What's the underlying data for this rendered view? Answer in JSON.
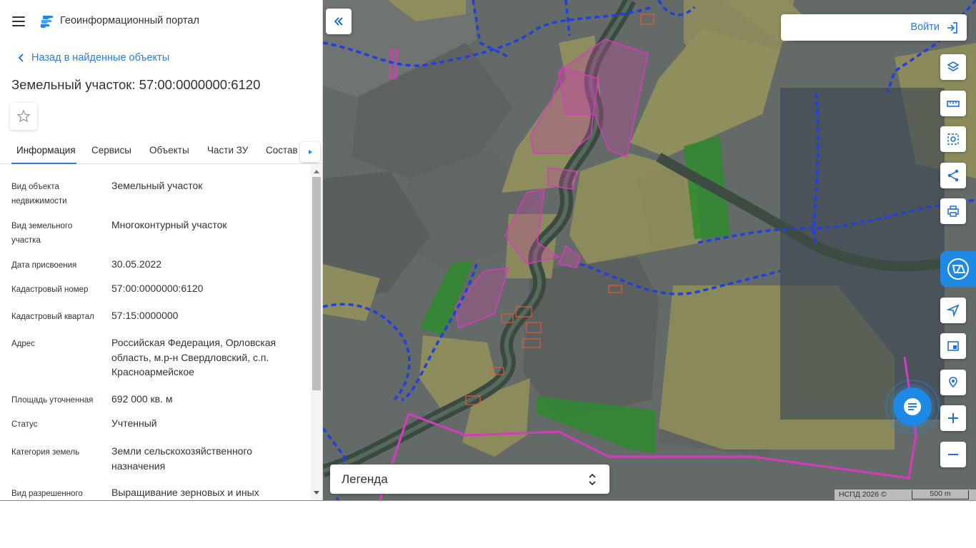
{
  "header": {
    "portal_title": "Геоинформационный портал",
    "menu_icon": "hamburger-menu-icon",
    "logo_icon": "portal-logo-icon"
  },
  "back_link": "Назад в найденные объекты",
  "object_title": "Земельный участок: 57:00:0000000:6120",
  "tabs": [
    {
      "label": "Информация",
      "active": true
    },
    {
      "label": "Сервисы",
      "active": false
    },
    {
      "label": "Объекты",
      "active": false
    },
    {
      "label": "Части ЗУ",
      "active": false
    },
    {
      "label": "Состав",
      "active": false
    }
  ],
  "info": [
    {
      "label": "Вид объекта недвижимости",
      "value": "Земельный участок"
    },
    {
      "label": "Вид земельного участка",
      "value": "Многоконтурный участок"
    },
    {
      "label": "Дата присвоения",
      "value": "30.05.2022"
    },
    {
      "label": "Кадастровый номер",
      "value": "57:00:0000000:6120"
    },
    {
      "label": "Кадастровый квартал",
      "value": "57:15:0000000"
    },
    {
      "label": "Адрес",
      "value": "Российская Федерация, Орловская область, м.р-н Свердловский, с.п. Красноармейское"
    },
    {
      "label": "Площадь уточненная",
      "value": "692 000 кв. м"
    },
    {
      "label": "Статус",
      "value": "Учтенный"
    },
    {
      "label": "Категория земель",
      "value": "Земли сельскохозяйственного назначения"
    },
    {
      "label": "Вид разрешенного",
      "value": "Выращивание зерновых и иных"
    }
  ],
  "map": {
    "login_label": "Войти",
    "legend_label": "Легенда",
    "attribution": "НСПД 2026 ©",
    "scale_label": "500 m",
    "tools": [
      "layers-icon",
      "ruler-icon",
      "area-select-icon",
      "share-icon",
      "print-icon",
      "egrn-icon",
      "navigate-icon",
      "minimap-icon",
      "geolocation-icon",
      "zoom-in-icon",
      "zoom-out-icon",
      "chat-icon"
    ]
  },
  "colors": {
    "accent": "#2a7de1",
    "parcel_pink": "#d63bbf",
    "field_yellow": "#c9c46a",
    "boundary_blue": "#1f3fe0",
    "forest_green": "#3fa83a"
  }
}
